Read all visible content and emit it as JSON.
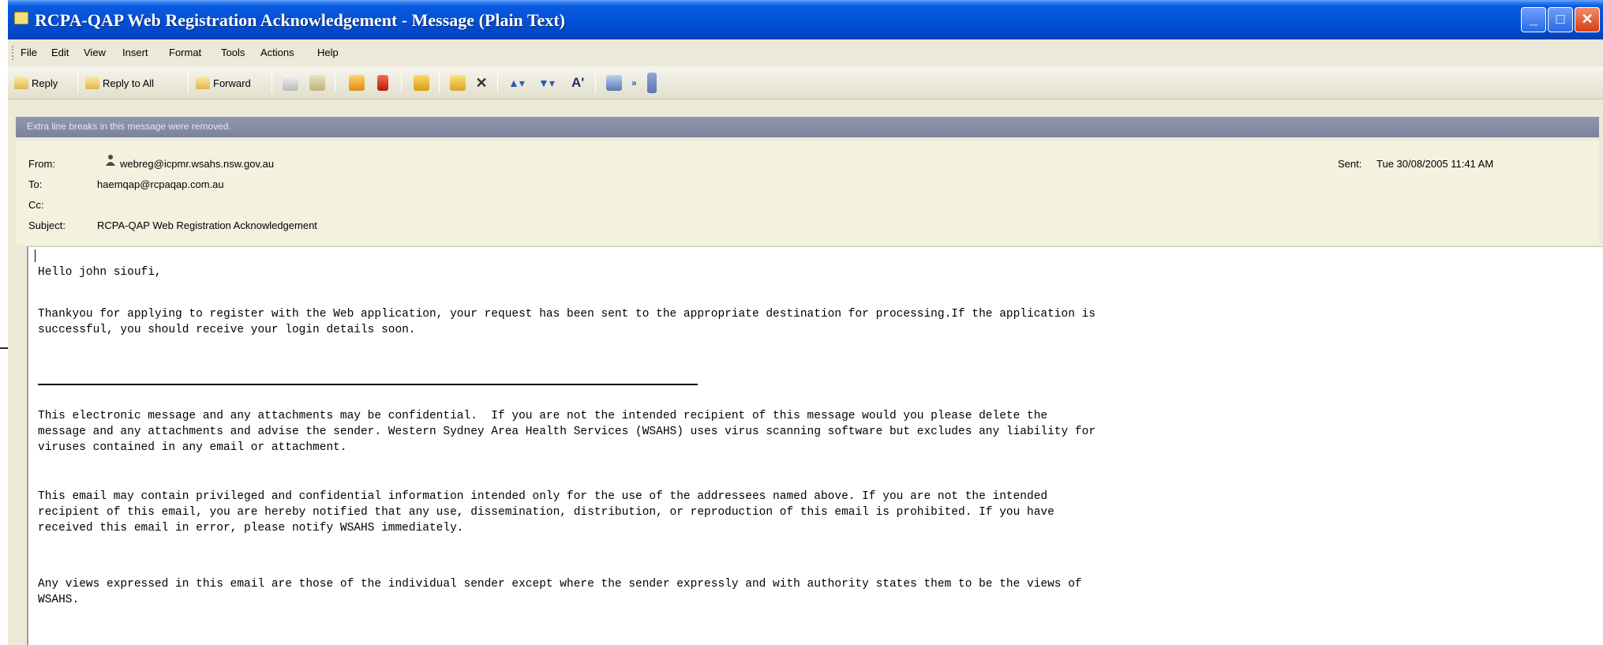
{
  "window": {
    "title": "RCPA-QAP Web Registration Acknowledgement - Message (Plain Text)",
    "controls": {
      "minimize": "_",
      "maximize": "□",
      "close": "✕"
    }
  },
  "menubar": {
    "items": [
      "File",
      "Edit",
      "View",
      "Insert",
      "Format",
      "Tools",
      "Actions",
      "Help"
    ]
  },
  "toolbar": {
    "reply": "Reply",
    "reply_all": "Reply to All",
    "forward": "Forward",
    "icons": [
      "print-icon",
      "move-icon",
      "flag-icon",
      "categories-icon",
      "address-book-icon",
      "delete-icon",
      "previous-item-icon",
      "next-item-icon",
      "font-size-icon",
      "find-icon",
      "options-icon"
    ]
  },
  "infoband": {
    "text": "Extra line breaks in this message were removed."
  },
  "header": {
    "from_label": "From:",
    "from_value": "webreg@icpmr.wsahs.nsw.gov.au",
    "to_label": "To:",
    "to_value": "haemqap@rcpaqap.com.au",
    "cc_label": "Cc:",
    "cc_value": "",
    "subject_label": "Subject:",
    "subject_value": "RCPA-QAP Web Registration Acknowledgement",
    "sent_label": "Sent:",
    "sent_value": "Tue 30/08/2005 11:41 AM"
  },
  "body": {
    "greeting": "Hello john sioufi,",
    "paragraph1": "Thankyou for applying to register with the Web application, your request has been sent to the appropriate destination for processing.If the application is\nsuccessful, you should receive your login details soon.",
    "disclaimer1": "This electronic message and any attachments may be confidential.  If you are not the intended recipient of this message would you please delete the\nmessage and any attachments and advise the sender. Western Sydney Area Health Services (WSAHS) uses virus scanning software but excludes any liability for\nviruses contained in any email or attachment.",
    "disclaimer2": "This email may contain privileged and confidential information intended only for the use of the addressees named above. If you are not the intended\nrecipient of this email, you are hereby notified that any use, dissemination, distribution, or reproduction of this email is prohibited. If you have\nreceived this email in error, please notify WSAHS immediately.",
    "disclaimer3": "Any views expressed in this email are those of the individual sender except where the sender expressly and with authority states them to be the views of\nWSAHS."
  },
  "colors": {
    "titlebar": "#0352d8",
    "infoband": "#8f98ad",
    "header_bg": "#f4f1df",
    "chrome": "#ece9d8"
  }
}
